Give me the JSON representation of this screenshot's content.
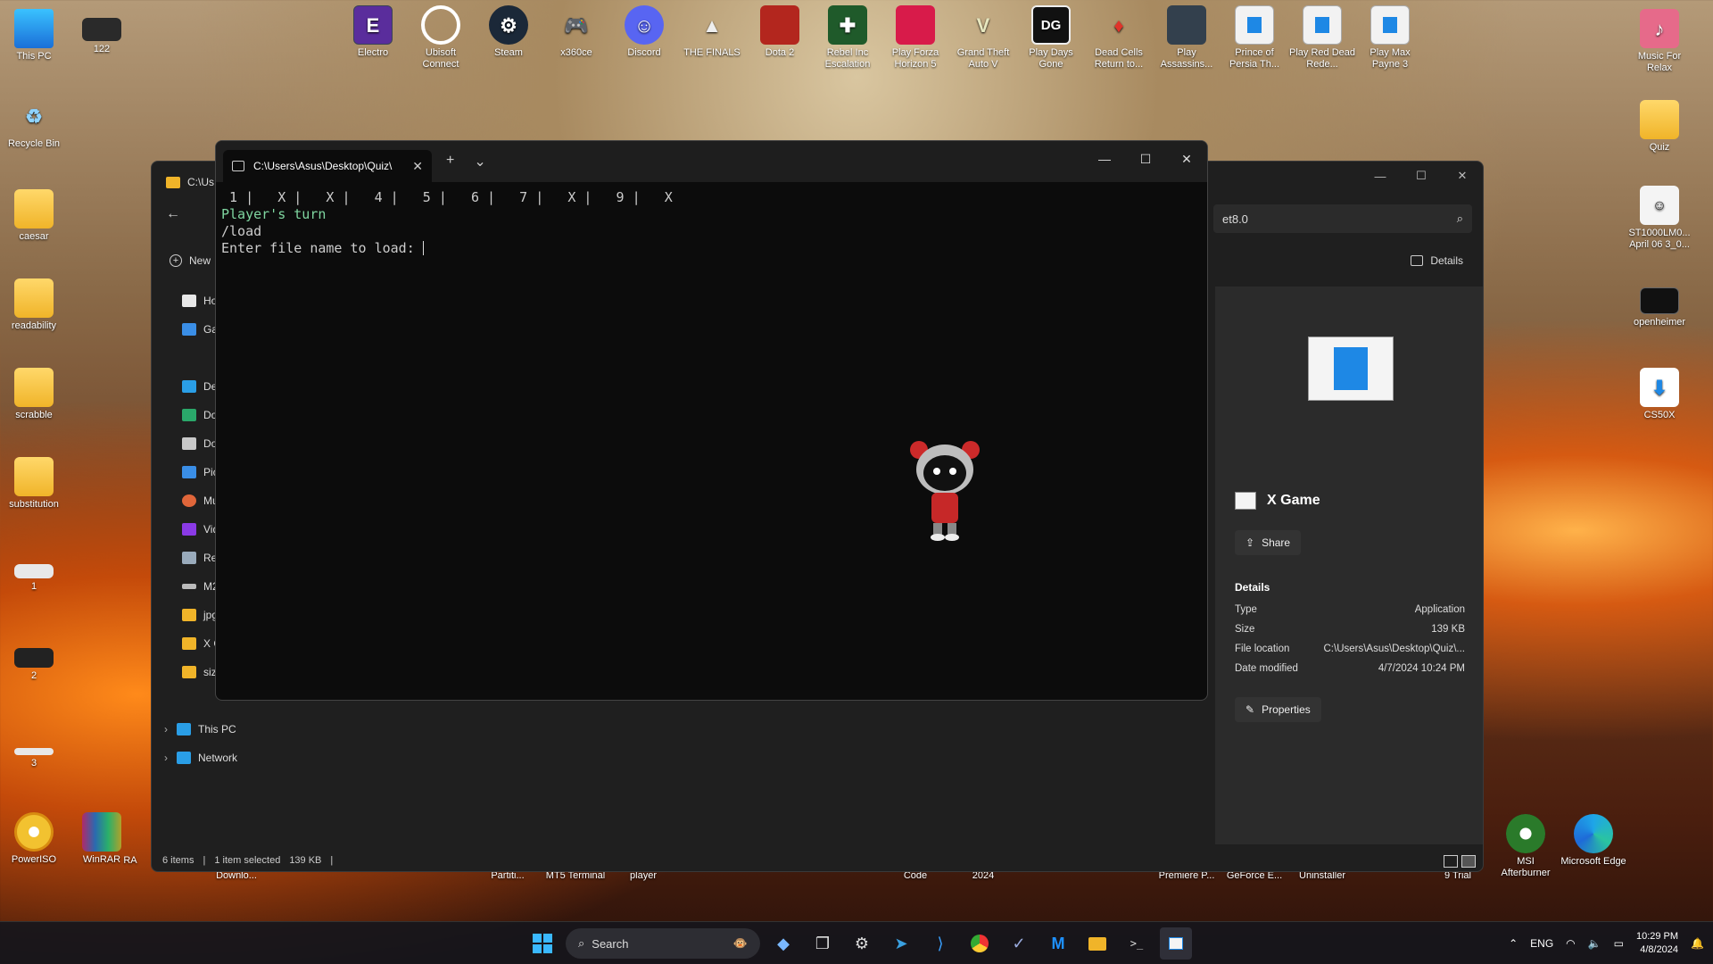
{
  "desktop": {
    "left_icons": [
      {
        "label": "This PC"
      },
      {
        "label": "122"
      },
      {
        "label": "Recycle Bin"
      },
      {
        "label": "caesar"
      },
      {
        "label": "readability"
      },
      {
        "label": "scrabble"
      },
      {
        "label": "substitution"
      },
      {
        "label": "1"
      },
      {
        "label": "2"
      },
      {
        "label": "3"
      },
      {
        "label": "PowerISO"
      },
      {
        "label": "WinRAR"
      }
    ],
    "top_icons": [
      {
        "label": "Electro"
      },
      {
        "label": "Ubisoft Connect"
      },
      {
        "label": "Steam"
      },
      {
        "label": "x360ce"
      },
      {
        "label": "Discord"
      },
      {
        "label": "THE FINALS"
      },
      {
        "label": "Dota 2"
      },
      {
        "label": "Rebel Inc Escalation"
      },
      {
        "label": "Play Forza Horizon 5"
      },
      {
        "label": "Grand Theft Auto V"
      },
      {
        "label": "Play Days Gone"
      },
      {
        "label": "Dead Cells Return to..."
      },
      {
        "label": "Play Assassins..."
      },
      {
        "label": "Prince of Persia Th..."
      },
      {
        "label": "Play Red Dead Rede..."
      },
      {
        "label": "Play Max Payne 3"
      }
    ],
    "right_icons": [
      {
        "label": "Music For Relax"
      },
      {
        "label": "Quiz"
      },
      {
        "label": "ST1000LM0... April 06 3_0..."
      },
      {
        "label": "openheimer"
      },
      {
        "label": "CS50X"
      },
      {
        "label": "MSI Afterburner"
      },
      {
        "label": "Microsoft Edge"
      }
    ],
    "partial_labels": [
      "Downlo...",
      "Partiti...",
      "MT5 Terminal",
      "player",
      "Code",
      "2024",
      "Premiere P...",
      "GeForce E...",
      "Uninstaller",
      "9 Trial",
      "RA"
    ]
  },
  "explorer": {
    "title": "C:\\Us",
    "search_value": "et8.0",
    "new_label": "New",
    "details_label": "Details",
    "nav_items": [
      {
        "label": "Ho"
      },
      {
        "label": "Gal"
      },
      {
        "label": "Des"
      },
      {
        "label": "Do"
      },
      {
        "label": "Do"
      },
      {
        "label": "Pic"
      },
      {
        "label": "Mu"
      },
      {
        "label": "Vid"
      },
      {
        "label": "Rec"
      },
      {
        "label": "M2"
      },
      {
        "label": "jpg"
      },
      {
        "label": "X G"
      },
      {
        "label": "size"
      }
    ],
    "tree_items": [
      {
        "label": "This PC"
      },
      {
        "label": "Network"
      }
    ],
    "preview": {
      "name": "X Game",
      "share_label": "Share",
      "details_heading": "Details",
      "props": [
        {
          "key": "Type",
          "value": "Application"
        },
        {
          "key": "Size",
          "value": "139 KB"
        },
        {
          "key": "File location",
          "value": "C:\\Users\\Asus\\Desktop\\Quiz\\..."
        },
        {
          "key": "Date modified",
          "value": "4/7/2024 10:24 PM"
        }
      ],
      "properties_label": "Properties"
    },
    "status": {
      "items": "6 items",
      "selected": "1 item selected",
      "size": "139 KB"
    }
  },
  "terminal": {
    "tab_title": "C:\\Users\\Asus\\Desktop\\Quiz\\",
    "new_tab": "+",
    "dropdown": "⌄",
    "lines": {
      "board": " 1 |   X |   X |   4 |   5 |   6 |   7 |   X |   9 |   X",
      "turn": "Player's turn",
      "command": "/load",
      "prompt": "Enter file name to load: "
    }
  },
  "taskbar": {
    "search_placeholder": "Search",
    "language": "ENG",
    "time": "10:29 PM",
    "date": "4/8/2024"
  },
  "colors": {
    "terminal_bg": "#0c0c0c",
    "terminal_green": "#7fd6a0",
    "explorer_bg": "#1f1f1f",
    "taskbar_bg": "#16161c"
  }
}
